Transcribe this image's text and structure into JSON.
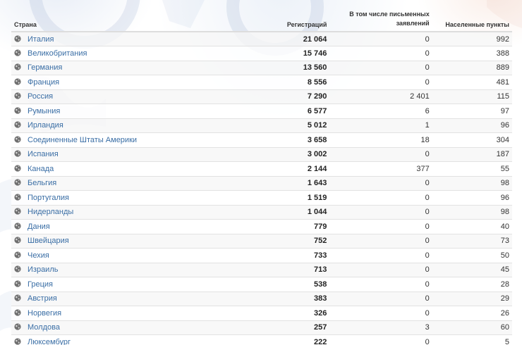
{
  "table": {
    "headers": {
      "country": "Страна",
      "registrations": "Регистраций",
      "written_line1": "В том числе письменных",
      "written_line2": "заявлений",
      "places": "Населенные пункты"
    },
    "rows": [
      {
        "country": "Италия",
        "registrations": "21 064",
        "written": "0",
        "places": "992"
      },
      {
        "country": "Великобритания",
        "registrations": "15 746",
        "written": "0",
        "places": "388"
      },
      {
        "country": "Германия",
        "registrations": "13 560",
        "written": "0",
        "places": "889"
      },
      {
        "country": "Франция",
        "registrations": "8 556",
        "written": "0",
        "places": "481"
      },
      {
        "country": "Россия",
        "registrations": "7 290",
        "written": "2 401",
        "places": "115"
      },
      {
        "country": "Румыния",
        "registrations": "6 577",
        "written": "6",
        "places": "97"
      },
      {
        "country": "Ирландия",
        "registrations": "5 012",
        "written": "1",
        "places": "96"
      },
      {
        "country": "Соединенные Штаты Америки",
        "registrations": "3 658",
        "written": "18",
        "places": "304"
      },
      {
        "country": "Испания",
        "registrations": "3 002",
        "written": "0",
        "places": "187"
      },
      {
        "country": "Канада",
        "registrations": "2 144",
        "written": "377",
        "places": "55"
      },
      {
        "country": "Бельгия",
        "registrations": "1 643",
        "written": "0",
        "places": "98"
      },
      {
        "country": "Португалия",
        "registrations": "1 519",
        "written": "0",
        "places": "96"
      },
      {
        "country": "Нидерланды",
        "registrations": "1 044",
        "written": "0",
        "places": "98"
      },
      {
        "country": "Дания",
        "registrations": "779",
        "written": "0",
        "places": "40"
      },
      {
        "country": "Швейцария",
        "registrations": "752",
        "written": "0",
        "places": "73"
      },
      {
        "country": "Чехия",
        "registrations": "733",
        "written": "0",
        "places": "50"
      },
      {
        "country": "Израиль",
        "registrations": "713",
        "written": "0",
        "places": "45"
      },
      {
        "country": "Греция",
        "registrations": "538",
        "written": "0",
        "places": "28"
      },
      {
        "country": "Австрия",
        "registrations": "383",
        "written": "0",
        "places": "29"
      },
      {
        "country": "Норвегия",
        "registrations": "326",
        "written": "0",
        "places": "26"
      },
      {
        "country": "Молдова",
        "registrations": "257",
        "written": "3",
        "places": "60"
      },
      {
        "country": "Люксембург",
        "registrations": "222",
        "written": "0",
        "places": "5"
      }
    ]
  },
  "icons": {
    "row_icon": "globe-icon"
  },
  "colors": {
    "link": "#3a6ea5",
    "header_rule": "#dddddd",
    "row_alt": "#f6f6f6"
  }
}
